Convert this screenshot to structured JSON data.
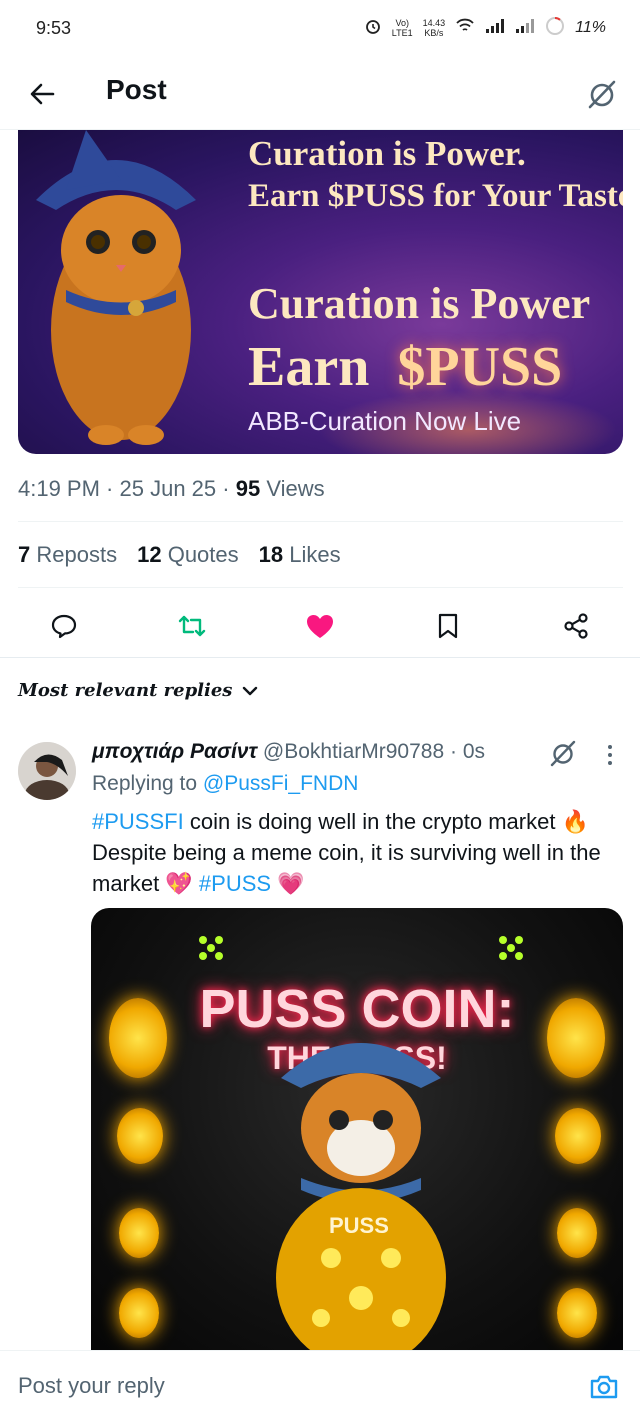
{
  "status_bar": {
    "time": "9:53",
    "net_line1": "Vo)",
    "net_line2": "LTE1",
    "speed_line1": "14.43",
    "speed_line2": "KB/s",
    "battery": "11%"
  },
  "header": {
    "title": "Post"
  },
  "banner": {
    "line1": "Curation is Power.",
    "line2": "Earn $PUSS for Your Taste",
    "line3": "Curation is Power",
    "line4_prefix": "Earn",
    "line4_accent": "$PUSS",
    "line5": "ABB-Curation Now Live"
  },
  "meta": {
    "time": "4:19 PM",
    "date": "25 Jun 25",
    "views_count": "95",
    "views_label": "Views"
  },
  "stats": {
    "reposts_count": "7",
    "reposts_label": "Reposts",
    "quotes_count": "12",
    "quotes_label": "Quotes",
    "likes_count": "18",
    "likes_label": "Likes"
  },
  "colors": {
    "accent": "#1d9bf0",
    "like": "#f91880",
    "repost": "#00ba7c",
    "muted": "#536471"
  },
  "replies_filter": {
    "label": "Most relevant replies"
  },
  "reply": {
    "name": "μποχτιάρ Ρασίντ",
    "handle": "@BokhtiarMr90788",
    "time": "0s",
    "replying_prefix": "Replying to",
    "replying_to": "@PussFi_FNDN",
    "hashtag1": "#PUSSFI",
    "text1": "coin is doing well in the crypto market",
    "emoji1": "🔥",
    "text2": "Despite being a meme coin, it is surviving well in the market",
    "emoji2": "💖",
    "hashtag2": "#PUSS",
    "emoji3": "💗",
    "image_title1": "PUSS COIN:",
    "image_title2": "THE F        OSS!",
    "image_badge": "PUSS"
  },
  "reply_bar": {
    "placeholder": "Post your reply"
  }
}
